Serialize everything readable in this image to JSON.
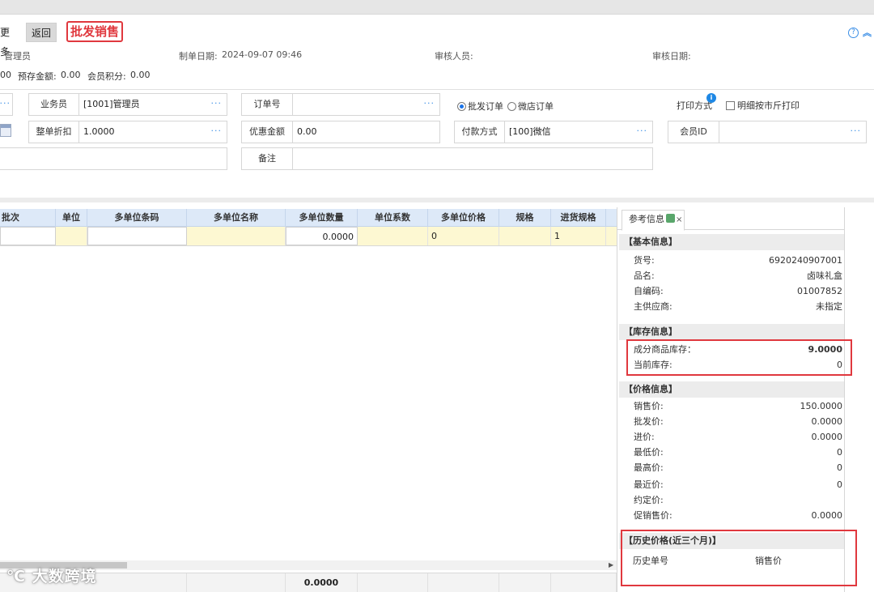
{
  "toolbar": {
    "more_label": "更多",
    "back_label": "返回",
    "title": "批发销售"
  },
  "header_info": {
    "operator": "管理员",
    "created_date_label": "制单日期:",
    "created_date": "2024-09-07 09:46",
    "auditor_label": "审核人员:",
    "audit_date_label": "审核日期:",
    "balance_prefix": "00",
    "prepaid_label": "预存金额:",
    "prepaid": "0.00",
    "points_label": "会员积分:",
    "points": "0.00"
  },
  "form": {
    "salesperson_label": "业务员",
    "salesperson": "[1001]管理员",
    "order_no_label": "订单号",
    "order_no": "",
    "radio_wholesale": "批发订单",
    "radio_wechat": "微店订单",
    "print_mode_label": "打印方式",
    "print_detail_by_jin": "明细按市斤打印",
    "discount_label": "整单折扣",
    "discount": "1.0000",
    "coupon_label": "优惠金额",
    "coupon": "0.00",
    "payment_label": "付款方式",
    "payment": "[100]微信",
    "member_label": "会员ID",
    "member": "",
    "remark_label": "备注",
    "remark": "",
    "more_dots": "···"
  },
  "grid": {
    "columns": [
      "批次",
      "单位",
      "多单位条码",
      "多单位名称",
      "多单位数量",
      "单位系数",
      "多单位价格",
      "规格",
      "进货规格"
    ],
    "row": {
      "qty": "0.0000",
      "factor": "0",
      "spec_in": "1"
    },
    "footer_total": "0.0000"
  },
  "watermark": "大数跨境",
  "panel": {
    "tab_label": "参考信息",
    "basic_title": "【基本信息】",
    "basic": [
      {
        "k": "货号:",
        "v": "6920240907001"
      },
      {
        "k": "品名:",
        "v": "卤味礼盒"
      },
      {
        "k": "自编码:",
        "v": "01007852"
      },
      {
        "k": "主供应商:",
        "v": "未指定"
      }
    ],
    "stock_title": "【库存信息】",
    "stock": [
      {
        "k": "成分商品库存：",
        "v": "9.0000"
      },
      {
        "k": "当前库存:",
        "v": "0"
      }
    ],
    "price_title": "【价格信息】",
    "price": [
      {
        "k": "销售价:",
        "v": "150.0000"
      },
      {
        "k": "批发价:",
        "v": "0.0000"
      },
      {
        "k": "进价:",
        "v": "0.0000"
      },
      {
        "k": "最低价:",
        "v": "0"
      },
      {
        "k": "最高价:",
        "v": "0"
      },
      {
        "k": "最近价:",
        "v": "0"
      },
      {
        "k": "约定价:",
        "v": ""
      },
      {
        "k": "促销售价:",
        "v": "0.0000"
      }
    ],
    "history_title": "【历史价格(近三个月)】",
    "history_col1": "历史单号",
    "history_col2": "销售价"
  },
  "colors": {
    "accent": "#3a8ee6",
    "highlight_red": "#e0383e",
    "grid_header": "#dde9f8",
    "cell_yellow": "#fdf8d2"
  }
}
